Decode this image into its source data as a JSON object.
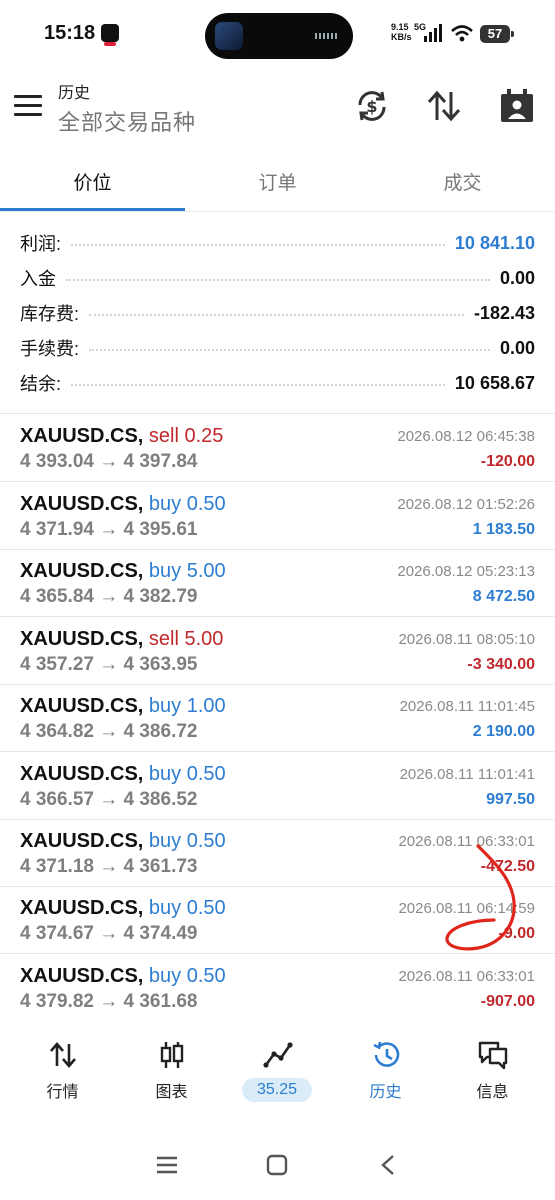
{
  "status_bar": {
    "time": "15:18",
    "net_speed_value": "9.15",
    "net_speed_unit": "KB/s",
    "network": "5G",
    "battery": "57"
  },
  "header": {
    "title": "历史",
    "subtitle": "全部交易品种",
    "icons": [
      "menu-icon",
      "currency-refresh-icon",
      "sort-icon",
      "calendar-icon"
    ]
  },
  "tabs": [
    {
      "label": "价位",
      "active": true
    },
    {
      "label": "订单",
      "active": false
    },
    {
      "label": "成交",
      "active": false
    }
  ],
  "summary": [
    {
      "label": "利润:",
      "value": "10 841.10",
      "highlight": true
    },
    {
      "label": "入金",
      "value": "0.00",
      "highlight": false
    },
    {
      "label": "库存费:",
      "value": "-182.43",
      "highlight": false
    },
    {
      "label": "手续费:",
      "value": "0.00",
      "highlight": false
    },
    {
      "label": "结余:",
      "value": "10 658.67",
      "highlight": false
    }
  ],
  "deals": [
    {
      "symbol": "XAUUSD.CS,",
      "side": "sell 0.25",
      "type": "sell",
      "prices": "4 393.04 → 4 397.84",
      "date": "2026.08.12 06:45:38",
      "profit": "-120.00",
      "positive": false
    },
    {
      "symbol": "XAUUSD.CS,",
      "side": "buy 0.50",
      "type": "buy",
      "prices": "4 371.94 → 4 395.61",
      "date": "2026.08.12 01:52:26",
      "profit": "1 183.50",
      "positive": true
    },
    {
      "symbol": "XAUUSD.CS,",
      "side": "buy 5.00",
      "type": "buy",
      "prices": "4 365.84 → 4 382.79",
      "date": "2026.08.12 05:23:13",
      "profit": "8 472.50",
      "positive": true
    },
    {
      "symbol": "XAUUSD.CS,",
      "side": "sell 5.00",
      "type": "sell",
      "prices": "4 357.27 → 4 363.95",
      "date": "2026.08.11 08:05:10",
      "profit": "-3 340.00",
      "positive": false
    },
    {
      "symbol": "XAUUSD.CS,",
      "side": "buy 1.00",
      "type": "buy",
      "prices": "4 364.82 → 4 386.72",
      "date": "2026.08.11 11:01:45",
      "profit": "2 190.00",
      "positive": true
    },
    {
      "symbol": "XAUUSD.CS,",
      "side": "buy 0.50",
      "type": "buy",
      "prices": "4 366.57 → 4 386.52",
      "date": "2026.08.11 11:01:41",
      "profit": "997.50",
      "positive": true
    },
    {
      "symbol": "XAUUSD.CS,",
      "side": "buy 0.50",
      "type": "buy",
      "prices": "4 371.18 → 4 361.73",
      "date": "2026.08.11 06:33:01",
      "profit": "-472.50",
      "positive": false
    },
    {
      "symbol": "XAUUSD.CS,",
      "side": "buy 0.50",
      "type": "buy",
      "prices": "4 374.67 → 4 374.49",
      "date": "2026.08.11 06:14:59",
      "profit": "-9.00",
      "positive": false
    },
    {
      "symbol": "XAUUSD.CS,",
      "side": "buy 0.50",
      "type": "buy",
      "prices": "4 379.82 → 4 361.68",
      "date": "2026.08.11 06:33:01",
      "profit": "-907.00",
      "positive": false
    }
  ],
  "bottom_nav": [
    {
      "label": "行情",
      "icon": "quotes-icon",
      "active": false
    },
    {
      "label": "图表",
      "icon": "chart-candles-icon",
      "active": false
    },
    {
      "label": "35.25",
      "icon": "trade-line-icon",
      "active": false
    },
    {
      "label": "历史",
      "icon": "history-icon",
      "active": true
    },
    {
      "label": "信息",
      "icon": "messages-icon",
      "active": false
    }
  ],
  "colors": {
    "accent_blue": "#2d7dd2",
    "loss_red": "#c0282d",
    "annotation_red": "#e0251b"
  }
}
